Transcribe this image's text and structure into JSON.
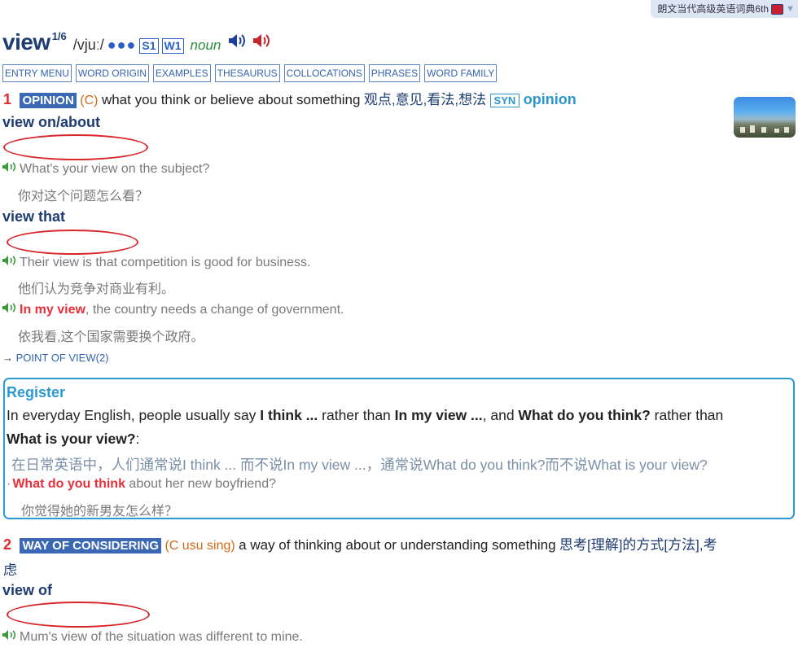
{
  "dictionary_tab": {
    "label": "朗文当代高级英语词典6th"
  },
  "entry": {
    "headword": "view",
    "homnum": "1/6",
    "pronunciation": "/vjuː/",
    "frequency_dots": "●●●",
    "spoken_freq": "S1",
    "written_freq": "W1",
    "pos": "noun"
  },
  "tabs": [
    "ENTRY MENU",
    "WORD ORIGIN",
    "EXAMPLES",
    "THESAURUS",
    "COLLOCATIONS",
    "PHRASES",
    "WORD FAMILY"
  ],
  "sense1": {
    "num": "1",
    "signpost": "OPINION",
    "gram": "(C)",
    "def": "what you think or believe about something",
    "cn": "观点,意见,看法,想法",
    "syn_label": "SYN",
    "syn_word": "opinion",
    "pattern1": "view on/about",
    "ex1": "What's your view on the subject?",
    "ex1_cn": "你对这个问题怎么看？",
    "pattern2": "view that",
    "ex2": "Their view is that competition is good for business.",
    "ex2_cn": "他们认为竞争对商业有利。",
    "ex3_bold": "In my view",
    "ex3_rest": ", the country needs a change of government.",
    "ex3_cn": "依我看,这个国家需要换个政府。",
    "ref_arrow": "→",
    "ref_link": "POINT OF VIEW(2)"
  },
  "register": {
    "title": "Register",
    "t1": "In everyday English, people usually say ",
    "b1": "I think ...",
    "t2": " rather than ",
    "b2": "In my view ...",
    "t3": ", and ",
    "b3": "What do you think?",
    "t4": " rather than",
    "b4": "What is your view?",
    "t5": ":",
    "cn": "在日常英语中，人们通常说I think ... 而不说In my view ...，通常说What do you think?而不说What is your view?",
    "ex_bullet": "·",
    "ex_bold": "What do you think",
    "ex_rest": " about her new boyfriend?",
    "ex_cn": "你觉得她的新男友怎么样？"
  },
  "sense2": {
    "num": "2",
    "signpost": "WAY OF CONSIDERING",
    "gram": "(C usu sing)",
    "def": "a way of thinking about or understanding something",
    "cn": "思考[理解]的方式[方法],考",
    "cn_wrap": "虑",
    "pattern1": "view of",
    "ex1": "Mum's view of the situation was different to mine."
  }
}
